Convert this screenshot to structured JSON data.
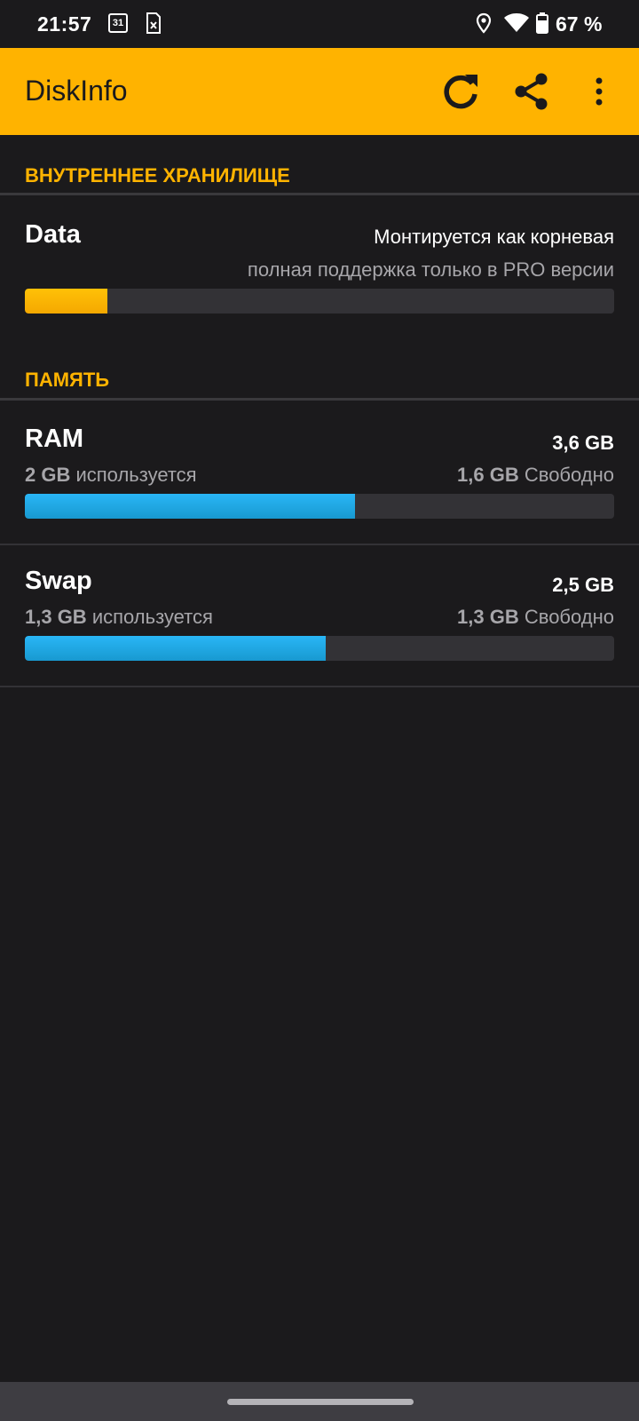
{
  "status_bar": {
    "time": "21:57",
    "calendar_day": "31",
    "battery": "67 %",
    "icons": [
      "calendar-icon",
      "sim-icon",
      "location-icon",
      "wifi-icon",
      "battery-icon"
    ]
  },
  "app_bar": {
    "title": "DiskInfo",
    "color": "#ffb300",
    "actions": [
      "refresh-icon",
      "share-icon",
      "more-vert-icon"
    ]
  },
  "internal_storage": {
    "section_title": "ВНУТРЕННЕЕ ХРАНИЛИЩЕ",
    "item": {
      "name": "Data",
      "mount_text": "Монтируется как корневая",
      "pro_text": "полная поддержка только в PRO версии",
      "usage_fraction": 0.14
    }
  },
  "memory": {
    "section_title": "ПАМЯТЬ",
    "ram": {
      "name": "RAM",
      "total": "3,6 GB",
      "used_value": "2 GB",
      "used_label": "используется",
      "free_value": "1,6 GB",
      "free_label": "Свободно",
      "usage_fraction": 0.56
    },
    "swap": {
      "name": "Swap",
      "total": "2,5 GB",
      "used_value": "1,3 GB",
      "used_label": "используется",
      "free_value": "1,3 GB",
      "free_label": "Свободно",
      "usage_fraction": 0.51
    }
  },
  "colors": {
    "accent": "#ffb300",
    "background": "#1b1a1c",
    "bar_track": "#333236",
    "ram_bar": "#1ea6e0",
    "storage_bar": "#ffb300"
  }
}
